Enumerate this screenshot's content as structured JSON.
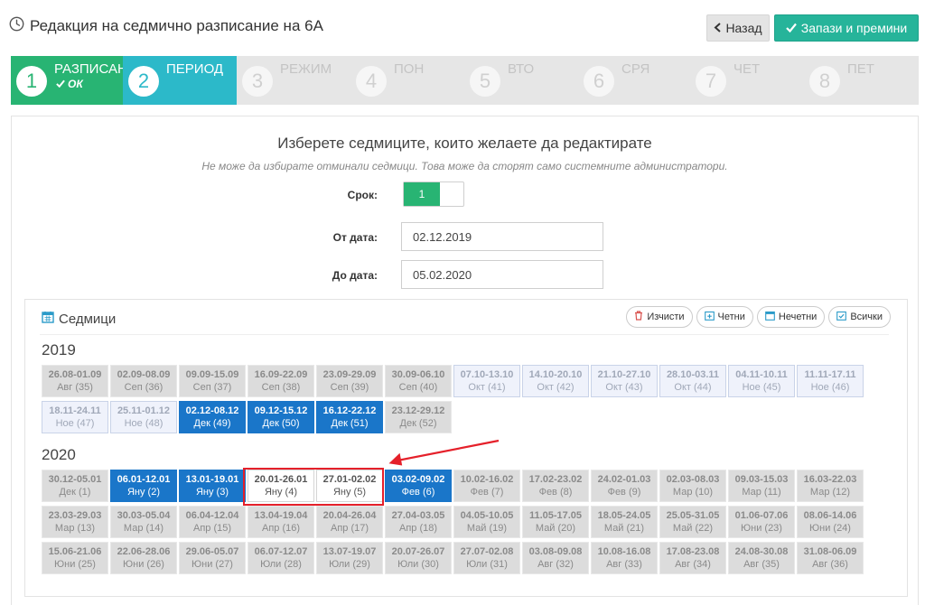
{
  "header": {
    "title": "Редакция на седмично разписание на 6А",
    "back_label": "Назад",
    "save_label": "Запази и премини"
  },
  "steps": [
    {
      "num": "1",
      "label": "РАЗПИСАН",
      "sub": "ОК",
      "state": "done"
    },
    {
      "num": "2",
      "label": "ПЕРИОД",
      "sub": "",
      "state": "active"
    },
    {
      "num": "3",
      "label": "РЕЖИМ",
      "sub": "",
      "state": "pending"
    },
    {
      "num": "4",
      "label": "ПОН",
      "sub": "",
      "state": "pending"
    },
    {
      "num": "5",
      "label": "ВТО",
      "sub": "",
      "state": "pending"
    },
    {
      "num": "6",
      "label": "СРЯ",
      "sub": "",
      "state": "pending"
    },
    {
      "num": "7",
      "label": "ЧЕТ",
      "sub": "",
      "state": "pending"
    },
    {
      "num": "8",
      "label": "ПЕТ",
      "sub": "",
      "state": "pending"
    }
  ],
  "form": {
    "heading": "Изберете седмиците, които желаете да редактирате",
    "note": "Не може да избирате отминали седмици. Това може да сторят само системните администратори.",
    "term_label": "Срок:",
    "term_value": "1",
    "from_label": "От дата:",
    "from_value": "02.12.2019",
    "to_label": "До дата:",
    "to_value": "05.02.2020"
  },
  "weeks": {
    "title": "Седмици",
    "tools": {
      "clear": "Изчисти",
      "even": "Четни",
      "odd": "Нечетни",
      "all": "Всички"
    },
    "year1": "2019",
    "year2": "2020",
    "y2019": [
      {
        "d": "26.08-01.09",
        "m": "Авг (35)",
        "s": "past"
      },
      {
        "d": "02.09-08.09",
        "m": "Сеп (36)",
        "s": "past"
      },
      {
        "d": "09.09-15.09",
        "m": "Сеп (37)",
        "s": "past"
      },
      {
        "d": "16.09-22.09",
        "m": "Сеп (38)",
        "s": "past"
      },
      {
        "d": "23.09-29.09",
        "m": "Сеп (39)",
        "s": "past"
      },
      {
        "d": "30.09-06.10",
        "m": "Сеп (40)",
        "s": "past"
      },
      {
        "d": "07.10-13.10",
        "m": "Окт (41)",
        "s": "light"
      },
      {
        "d": "14.10-20.10",
        "m": "Окт (42)",
        "s": "light"
      },
      {
        "d": "21.10-27.10",
        "m": "Окт (43)",
        "s": "light"
      },
      {
        "d": "28.10-03.11",
        "m": "Окт (44)",
        "s": "light"
      },
      {
        "d": "04.11-10.11",
        "m": "Ное (45)",
        "s": "light"
      },
      {
        "d": "11.11-17.11",
        "m": "Ное (46)",
        "s": "light"
      },
      {
        "d": "18.11-24.11",
        "m": "Ное (47)",
        "s": "light"
      },
      {
        "d": "25.11-01.12",
        "m": "Ное (48)",
        "s": "light"
      },
      {
        "d": "02.12-08.12",
        "m": "Дек (49)",
        "s": "sel"
      },
      {
        "d": "09.12-15.12",
        "m": "Дек (50)",
        "s": "sel"
      },
      {
        "d": "16.12-22.12",
        "m": "Дек (51)",
        "s": "sel"
      },
      {
        "d": "23.12-29.12",
        "m": "Дек (52)",
        "s": "past"
      }
    ],
    "y2020": [
      {
        "d": "30.12-05.01",
        "m": "Дек (1)",
        "s": "past"
      },
      {
        "d": "06.01-12.01",
        "m": "Яну (2)",
        "s": "sel"
      },
      {
        "d": "13.01-19.01",
        "m": "Яну (3)",
        "s": "sel"
      },
      {
        "d": "20.01-26.01",
        "m": "Яну (4)",
        "s": "white"
      },
      {
        "d": "27.01-02.02",
        "m": "Яну (5)",
        "s": "white"
      },
      {
        "d": "03.02-09.02",
        "m": "Фев (6)",
        "s": "sel"
      },
      {
        "d": "10.02-16.02",
        "m": "Фев (7)",
        "s": "past"
      },
      {
        "d": "17.02-23.02",
        "m": "Фев (8)",
        "s": "past"
      },
      {
        "d": "24.02-01.03",
        "m": "Фев (9)",
        "s": "past"
      },
      {
        "d": "02.03-08.03",
        "m": "Мар (10)",
        "s": "past"
      },
      {
        "d": "09.03-15.03",
        "m": "Мар (11)",
        "s": "past"
      },
      {
        "d": "16.03-22.03",
        "m": "Мар (12)",
        "s": "past"
      },
      {
        "d": "23.03-29.03",
        "m": "Мар (13)",
        "s": "past"
      },
      {
        "d": "30.03-05.04",
        "m": "Мар (14)",
        "s": "past"
      },
      {
        "d": "06.04-12.04",
        "m": "Апр (15)",
        "s": "past"
      },
      {
        "d": "13.04-19.04",
        "m": "Апр (16)",
        "s": "past"
      },
      {
        "d": "20.04-26.04",
        "m": "Апр (17)",
        "s": "past"
      },
      {
        "d": "27.04-03.05",
        "m": "Апр (18)",
        "s": "past"
      },
      {
        "d": "04.05-10.05",
        "m": "Май (19)",
        "s": "past"
      },
      {
        "d": "11.05-17.05",
        "m": "Май (20)",
        "s": "past"
      },
      {
        "d": "18.05-24.05",
        "m": "Май (21)",
        "s": "past"
      },
      {
        "d": "25.05-31.05",
        "m": "Май (22)",
        "s": "past"
      },
      {
        "d": "01.06-07.06",
        "m": "Юни (23)",
        "s": "past"
      },
      {
        "d": "08.06-14.06",
        "m": "Юни (24)",
        "s": "past"
      },
      {
        "d": "15.06-21.06",
        "m": "Юни (25)",
        "s": "past"
      },
      {
        "d": "22.06-28.06",
        "m": "Юни (26)",
        "s": "past"
      },
      {
        "d": "29.06-05.07",
        "m": "Юни (27)",
        "s": "past"
      },
      {
        "d": "06.07-12.07",
        "m": "Юли (28)",
        "s": "past"
      },
      {
        "d": "13.07-19.07",
        "m": "Юли (29)",
        "s": "past"
      },
      {
        "d": "20.07-26.07",
        "m": "Юли (30)",
        "s": "past"
      },
      {
        "d": "27.07-02.08",
        "m": "Юли (31)",
        "s": "past"
      },
      {
        "d": "03.08-09.08",
        "m": "Авг (32)",
        "s": "past"
      },
      {
        "d": "10.08-16.08",
        "m": "Авг (33)",
        "s": "past"
      },
      {
        "d": "17.08-23.08",
        "m": "Авг (34)",
        "s": "past"
      },
      {
        "d": "24.08-30.08",
        "m": "Авг (35)",
        "s": "past"
      },
      {
        "d": "31.08-06.09",
        "m": "Авг (36)",
        "s": "past"
      }
    ]
  },
  "colors": {
    "done_step": "#28b473",
    "active_step": "#2cb9c9",
    "selected_week": "#1a76c9",
    "save_button": "#26b49a",
    "highlight": "#e5202a"
  }
}
